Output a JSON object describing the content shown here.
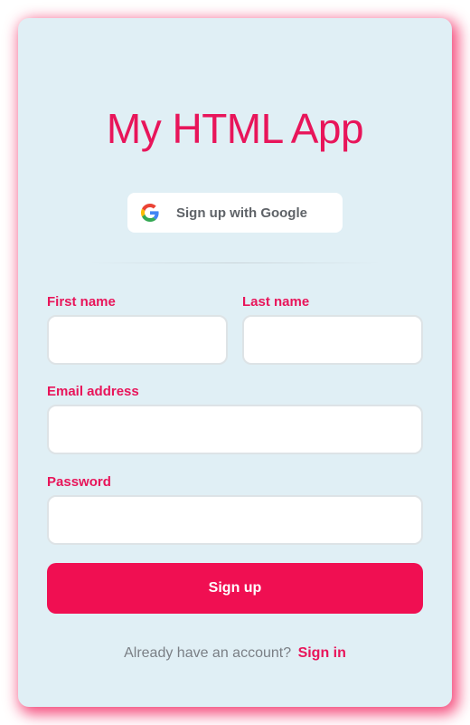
{
  "app": {
    "title": "My HTML App"
  },
  "google": {
    "label": "Sign up with Google",
    "icon": "google-g-icon"
  },
  "form": {
    "first_name": {
      "label": "First name",
      "value": "",
      "placeholder": ""
    },
    "last_name": {
      "label": "Last name",
      "value": "",
      "placeholder": ""
    },
    "email": {
      "label": "Email address",
      "value": "",
      "placeholder": ""
    },
    "password": {
      "label": "Password",
      "value": "",
      "placeholder": ""
    },
    "submit_label": "Sign up"
  },
  "footer": {
    "prompt": "Already have an account?",
    "link_label": "Sign in"
  },
  "colors": {
    "accent": "#e8155a",
    "button": "#f00f52",
    "card_background": "#e0eff5",
    "muted_text": "#7a7f85"
  }
}
